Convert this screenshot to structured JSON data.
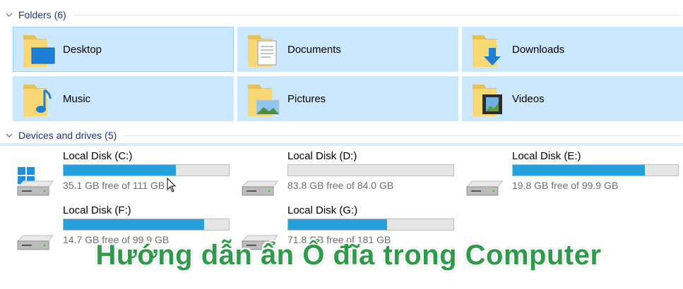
{
  "folders": {
    "header": "Folders (6)",
    "items": [
      {
        "label": "Desktop",
        "icon": "desktop-folder-icon"
      },
      {
        "label": "Documents",
        "icon": "documents-folder-icon"
      },
      {
        "label": "Downloads",
        "icon": "downloads-folder-icon"
      },
      {
        "label": "Music",
        "icon": "music-folder-icon"
      },
      {
        "label": "Pictures",
        "icon": "pictures-folder-icon"
      },
      {
        "label": "Videos",
        "icon": "videos-folder-icon"
      }
    ]
  },
  "drives": {
    "header": "Devices and drives (5)",
    "items": [
      {
        "name": "Local Disk (C:)",
        "free_text": "35.1 GB free of 111 GB",
        "used_fraction": 0.68,
        "icon": "windows-drive-icon"
      },
      {
        "name": "Local Disk (D:)",
        "free_text": "83.8 GB free of 84.0 GB",
        "used_fraction": 0.0,
        "icon": "hard-drive-icon"
      },
      {
        "name": "Local Disk (E:)",
        "free_text": "19.8 GB free of 99.9 GB",
        "used_fraction": 0.8,
        "icon": "hard-drive-icon"
      },
      {
        "name": "Local Disk (F:)",
        "free_text": "14.7 GB free of 99.9 GB",
        "used_fraction": 0.85,
        "icon": "hard-drive-icon"
      },
      {
        "name": "Local Disk (G:)",
        "free_text": "71.8 GB free of 181 GB",
        "used_fraction": 0.6,
        "icon": "hard-drive-icon"
      }
    ]
  },
  "caption": "Hướng dẫn ẩn Ổ đĩa trong Computer",
  "colors": {
    "selection": "#cce8ff",
    "bar_fill": "#26a0da",
    "header_text": "#1e3287",
    "caption": "#2f9a49"
  }
}
